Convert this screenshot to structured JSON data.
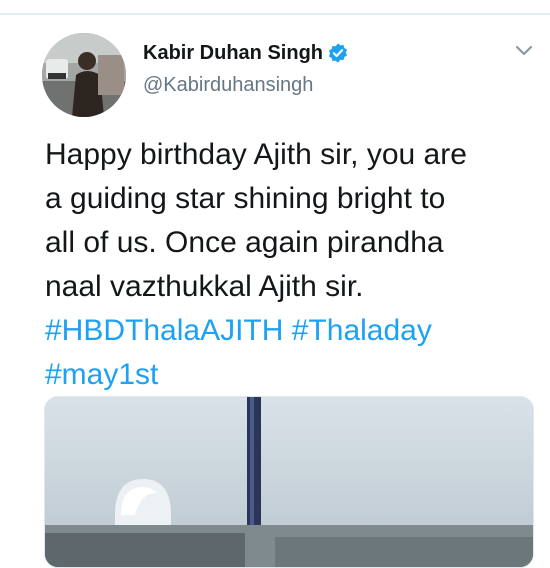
{
  "author": {
    "name": "Kabir Duhan Singh",
    "handle": "@Kabirduhansingh",
    "verified": true
  },
  "tweet": {
    "lines": [
      "Happy birthday Ajith sir, you are",
      "a guiding star shining bright to",
      "all of us. Once again pirandha",
      "naal vazthukkal Ajith sir."
    ],
    "hashtags": [
      "#HBDThalaAJITH",
      "#Thaladay",
      "#may1st"
    ]
  },
  "icons": {
    "verified": "verified-badge-icon",
    "caret": "chevron-down-icon"
  },
  "colors": {
    "link": "#1da1f2",
    "text": "#14171a",
    "secondary": "#657786",
    "divider": "#e6ecf0"
  }
}
